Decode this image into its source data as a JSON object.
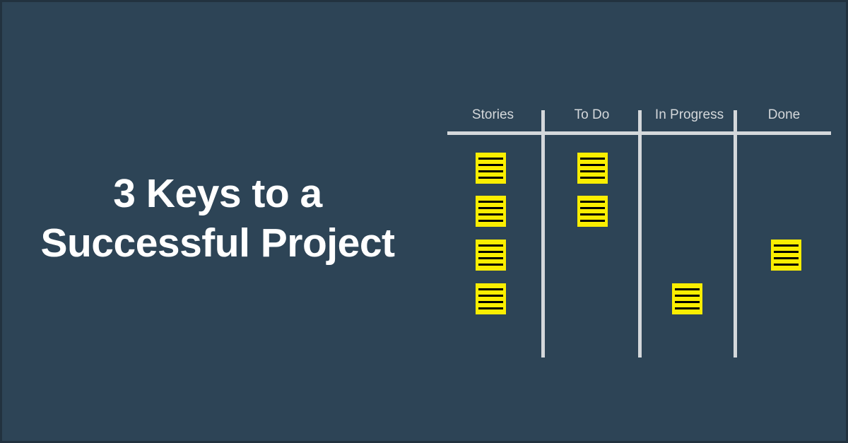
{
  "theme": {
    "background": "#2d4456",
    "border": "#22323f",
    "text_primary": "#ffffff",
    "text_muted": "#d4d8db",
    "rule": "#d4d8db",
    "note_fill": "#fbee00",
    "note_line": "#000000"
  },
  "headline": {
    "line1": "3 Keys to a",
    "line2": "Successful Project"
  },
  "board": {
    "columns": [
      {
        "id": "stories",
        "label": "Stories",
        "note_count": 4,
        "note_rows": [
          1,
          2,
          3,
          4
        ]
      },
      {
        "id": "todo",
        "label": "To Do",
        "note_count": 2,
        "note_rows": [
          1,
          2
        ]
      },
      {
        "id": "in-progress",
        "label": "In Progress",
        "note_count": 1,
        "note_rows": [
          4
        ]
      },
      {
        "id": "done",
        "label": "Done",
        "note_count": 1,
        "note_rows": [
          3
        ]
      }
    ],
    "note_lines_per_note": 4,
    "row_count": 4
  }
}
